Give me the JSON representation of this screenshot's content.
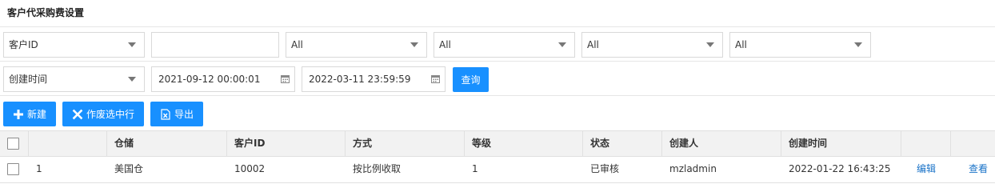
{
  "page": {
    "title": "客户代采购费设置"
  },
  "filters": {
    "field_select": "客户ID",
    "field_value": "",
    "select_1": "All",
    "select_2": "All",
    "select_3": "All",
    "select_4": "All",
    "date_field_select": "创建时间",
    "date_start": "2021-09-12 00:00:01",
    "date_end": "2022-03-11 23:59:59",
    "query_label": "查询"
  },
  "toolbar": {
    "new_label": "新建",
    "void_label": "作废选中行",
    "export_label": "导出"
  },
  "table": {
    "columns": [
      "仓储",
      "客户ID",
      "方式",
      "等级",
      "状态",
      "创建人",
      "创建时间"
    ],
    "rows": [
      {
        "index": "1",
        "warehouse": "美国仓",
        "customer_id": "10002",
        "method": "按比例收取",
        "level": "1",
        "status": "已审核",
        "creator": "mzladmin",
        "created_at": "2022-01-22 16:43:25",
        "edit_label": "编辑",
        "view_label": "查看"
      }
    ]
  },
  "colors": {
    "primary": "#1890ff",
    "link": "#1a73c8",
    "header_bg": "#f2f2f2"
  }
}
